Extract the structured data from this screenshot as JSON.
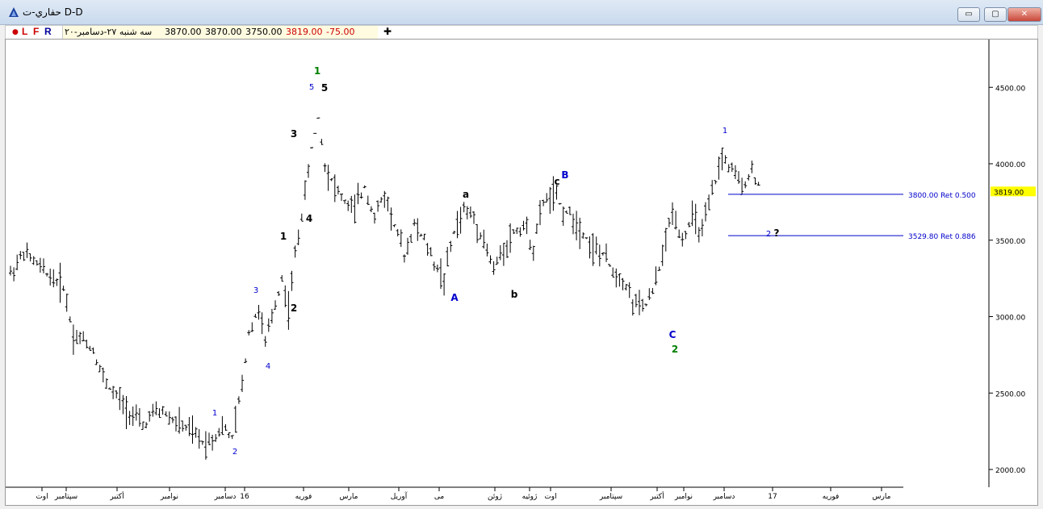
{
  "window": {
    "title": "حفاري-ت D-D",
    "minimize_label": "▭",
    "maximize_label": "▢",
    "close_label": "✕"
  },
  "toolbar": {
    "dot": "●",
    "flags": [
      {
        "label": "L",
        "color": "#cc0000"
      },
      {
        "label": "F",
        "color": "#cc0000"
      },
      {
        "label": "R",
        "color": "#000099"
      }
    ],
    "date": "سه شنبه ۲۷-دسامبر-۲۰",
    "open": "3870.00",
    "high": "3870.00",
    "low": "3750.00",
    "close": "3819.00",
    "change": "-75.00",
    "crosshair": "✚",
    "close_color": "#cc0000",
    "change_color": "#cc0000"
  },
  "chart_data": {
    "type": "bar",
    "subtype": "ohlc",
    "ylim": [
      1800,
      4800
    ],
    "y_ticks": [
      "4500.00",
      "4000.00",
      "3500.00",
      "3000.00",
      "2500.00",
      "2000.00"
    ],
    "last_price": {
      "value": 3819,
      "label": "3819.00",
      "color": "#ffff00"
    },
    "x_ticks": [
      "اوت",
      "سپتامبر",
      "أكتبر",
      "نوامبر",
      "دسامبر",
      "16",
      "فوريه",
      "مارس",
      "آوريل",
      "مى",
      "ژوئن",
      "ژوئيه",
      "اوت",
      "سپتامبر",
      "أكتبر",
      "نوامبر",
      "دسامبر",
      "17",
      "فوريه",
      "مارس"
    ],
    "price_path": [
      [
        0,
        3280
      ],
      [
        4,
        3420
      ],
      [
        7,
        3360
      ],
      [
        10,
        3300
      ],
      [
        13,
        3250
      ],
      [
        16,
        3200
      ],
      [
        19,
        2880
      ],
      [
        22,
        2850
      ],
      [
        25,
        2780
      ],
      [
        28,
        2600
      ],
      [
        31,
        2500
      ],
      [
        34,
        2430
      ],
      [
        37,
        2350
      ],
      [
        40,
        2280
      ],
      [
        43,
        2360
      ],
      [
        46,
        2380
      ],
      [
        49,
        2320
      ],
      [
        52,
        2280
      ],
      [
        55,
        2240
      ],
      [
        58,
        2180
      ],
      [
        61,
        2200
      ],
      [
        64,
        2280
      ],
      [
        67,
        2200
      ],
      [
        70,
        2550
      ],
      [
        72,
        2900
      ],
      [
        75,
        3050
      ],
      [
        77,
        2820
      ],
      [
        79,
        3000
      ],
      [
        82,
        3250
      ],
      [
        84,
        3050
      ],
      [
        86,
        3400
      ],
      [
        89,
        3800
      ],
      [
        91,
        4100
      ],
      [
        93,
        4300
      ],
      [
        95,
        4000
      ],
      [
        98,
        3850
      ],
      [
        101,
        3750
      ],
      [
        104,
        3700
      ],
      [
        107,
        3850
      ],
      [
        110,
        3650
      ],
      [
        113,
        3800
      ],
      [
        116,
        3600
      ],
      [
        119,
        3400
      ],
      [
        122,
        3600
      ],
      [
        125,
        3500
      ],
      [
        128,
        3350
      ],
      [
        131,
        3250
      ],
      [
        134,
        3550
      ],
      [
        137,
        3700
      ],
      [
        140,
        3650
      ],
      [
        143,
        3500
      ],
      [
        146,
        3300
      ],
      [
        149,
        3450
      ],
      [
        152,
        3550
      ],
      [
        155,
        3600
      ],
      [
        158,
        3450
      ],
      [
        161,
        3750
      ],
      [
        164,
        3800
      ],
      [
        167,
        3700
      ],
      [
        170,
        3650
      ],
      [
        173,
        3550
      ],
      [
        176,
        3450
      ],
      [
        179,
        3400
      ],
      [
        182,
        3300
      ],
      [
        185,
        3250
      ],
      [
        188,
        3100
      ],
      [
        191,
        3050
      ],
      [
        194,
        3150
      ],
      [
        197,
        3400
      ],
      [
        200,
        3700
      ],
      [
        203,
        3500
      ],
      [
        206,
        3650
      ],
      [
        209,
        3550
      ],
      [
        212,
        3800
      ],
      [
        215,
        4050
      ],
      [
        218,
        3950
      ],
      [
        221,
        3850
      ],
      [
        224,
        3950
      ],
      [
        227,
        3819
      ]
    ],
    "elliott_labels": [
      {
        "text": "1",
        "x": 265,
        "y": 510,
        "color": "#0000cc",
        "bold": false
      },
      {
        "text": "2",
        "x": 290,
        "y": 558,
        "color": "#0000cc",
        "bold": false
      },
      {
        "text": "3",
        "x": 316,
        "y": 358,
        "color": "#0000cc",
        "bold": false
      },
      {
        "text": "4",
        "x": 331,
        "y": 452,
        "color": "#0000cc",
        "bold": false
      },
      {
        "text": "1",
        "x": 350,
        "y": 292,
        "color": "#000000",
        "bold": true
      },
      {
        "text": "2",
        "x": 363,
        "y": 381,
        "color": "#000000",
        "bold": true
      },
      {
        "text": "3",
        "x": 363,
        "y": 165,
        "color": "#000000",
        "bold": true
      },
      {
        "text": "4",
        "x": 382,
        "y": 270,
        "color": "#000000",
        "bold": true
      },
      {
        "text": "5",
        "x": 385,
        "y": 106,
        "color": "#0000cc",
        "bold": false
      },
      {
        "text": "5",
        "x": 401,
        "y": 108,
        "color": "#000000",
        "bold": true
      },
      {
        "text": "1",
        "x": 392,
        "y": 87,
        "color": "#008000",
        "bold": true
      },
      {
        "text": "A",
        "x": 562,
        "y": 368,
        "color": "#0000cc",
        "bold": true
      },
      {
        "text": "a",
        "x": 576,
        "y": 240,
        "color": "#000000",
        "bold": true
      },
      {
        "text": "b",
        "x": 636,
        "y": 364,
        "color": "#000000",
        "bold": true
      },
      {
        "text": "c",
        "x": 689,
        "y": 224,
        "color": "#000000",
        "bold": true
      },
      {
        "text": "B",
        "x": 699,
        "y": 216,
        "color": "#0000cc",
        "bold": true
      },
      {
        "text": "C",
        "x": 832,
        "y": 414,
        "color": "#0000cc",
        "bold": true
      },
      {
        "text": "2",
        "x": 835,
        "y": 432,
        "color": "#008000",
        "bold": true
      },
      {
        "text": "1",
        "x": 897,
        "y": 160,
        "color": "#0000cc",
        "bold": false
      },
      {
        "text": "2",
        "x": 951,
        "y": 288,
        "color": "#0000cc",
        "bold": false
      },
      {
        "text": "?",
        "x": 961,
        "y": 288,
        "color": "#000000",
        "bold": true
      }
    ],
    "retracements": [
      {
        "label": "3800.00 Ret 0.500",
        "value": 3800,
        "color": "#0000cc"
      },
      {
        "label": "3529.80 Ret 0.886",
        "value": 3529.8,
        "color": "#0000cc"
      }
    ]
  }
}
